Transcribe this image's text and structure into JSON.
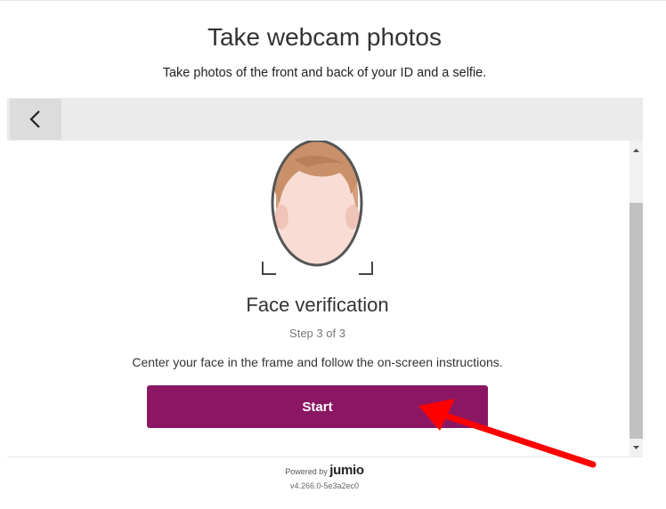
{
  "header": {
    "title": "Take webcam photos",
    "subtitle": "Take photos of the front and back of your ID and a selfie."
  },
  "icons": {
    "back": "chevron-left-icon",
    "face": "face-frame-icon",
    "scroll_up": "triangle-up-icon",
    "scroll_down": "triangle-down-icon",
    "annotation": "red-arrow-icon"
  },
  "verification": {
    "title": "Face verification",
    "step": "Step 3 of 3",
    "instructions": "Center your face in the frame and follow the on-screen instructions.",
    "start_label": "Start"
  },
  "footer": {
    "powered_by": "Powered by",
    "brand": "jumio",
    "version": "v4.266.0-5e3a2ec0"
  },
  "colors": {
    "accent": "#8b1764",
    "annotation": "#ff0000",
    "header_bar": "#ebebeb"
  }
}
